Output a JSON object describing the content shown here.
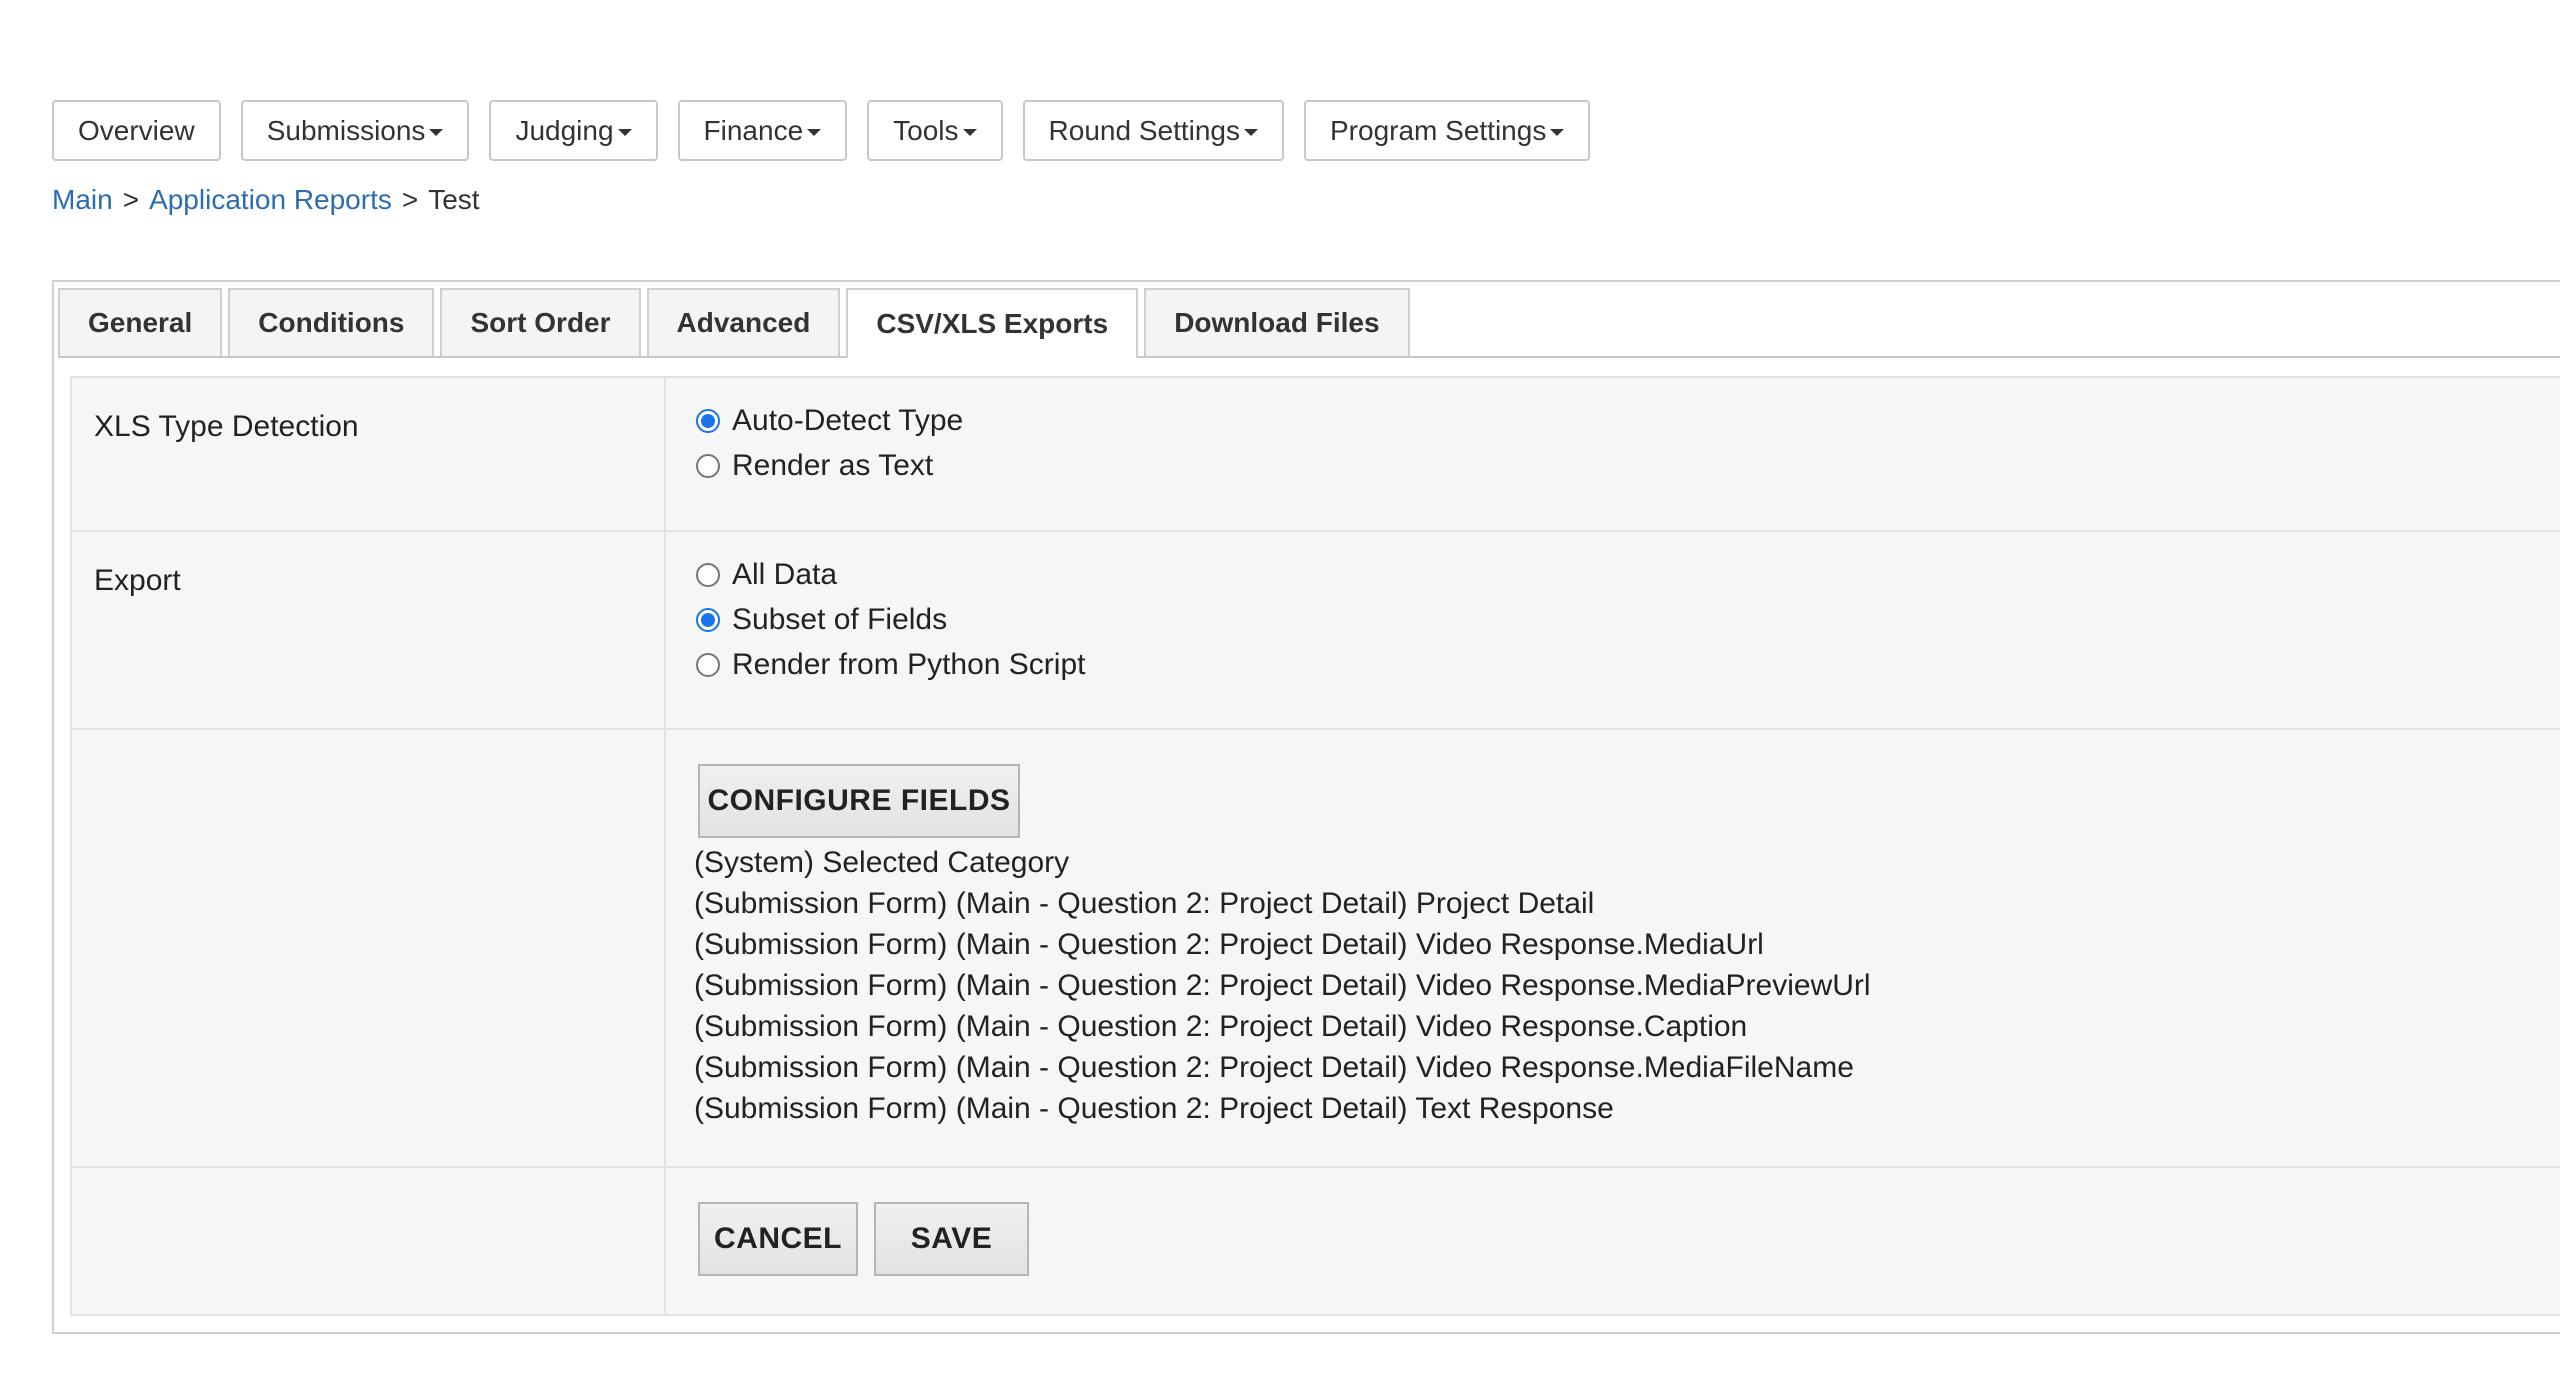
{
  "nav": {
    "items": [
      {
        "label": "Overview",
        "dropdown": false
      },
      {
        "label": "Submissions",
        "dropdown": true
      },
      {
        "label": "Judging",
        "dropdown": true
      },
      {
        "label": "Finance",
        "dropdown": true
      },
      {
        "label": "Tools",
        "dropdown": true
      },
      {
        "label": "Round Settings",
        "dropdown": true
      },
      {
        "label": "Program Settings",
        "dropdown": true
      }
    ]
  },
  "breadcrumb": {
    "items": [
      "Main",
      "Application Reports",
      "Test"
    ],
    "separator": ">"
  },
  "tabs": {
    "items": [
      "General",
      "Conditions",
      "Sort Order",
      "Advanced",
      "CSV/XLS Exports",
      "Download Files"
    ],
    "active": "CSV/XLS Exports"
  },
  "xls_detection": {
    "label": "XLS Type Detection",
    "options": [
      "Auto-Detect Type",
      "Render as Text"
    ],
    "selected": "Auto-Detect Type"
  },
  "export": {
    "label": "Export",
    "options": [
      "All Data",
      "Subset of Fields",
      "Render from Python Script"
    ],
    "selected": "Subset of Fields"
  },
  "fields": {
    "configure_label": "CONFIGURE FIELDS",
    "items": [
      "(System) Selected Category",
      "(Submission Form) (Main - Question 2: Project Detail) Project Detail",
      "(Submission Form) (Main - Question 2: Project Detail) Video Response.MediaUrl",
      "(Submission Form) (Main - Question 2: Project Detail) Video Response.MediaPreviewUrl",
      "(Submission Form) (Main - Question 2: Project Detail) Video Response.Caption",
      "(Submission Form) (Main - Question 2: Project Detail) Video Response.MediaFileName",
      "(Submission Form) (Main - Question 2: Project Detail) Text Response"
    ]
  },
  "actions": {
    "cancel_label": "CANCEL",
    "save_label": "SAVE"
  },
  "colors": {
    "link": "#2a6db0",
    "radio_selected": "#1a73e8"
  }
}
